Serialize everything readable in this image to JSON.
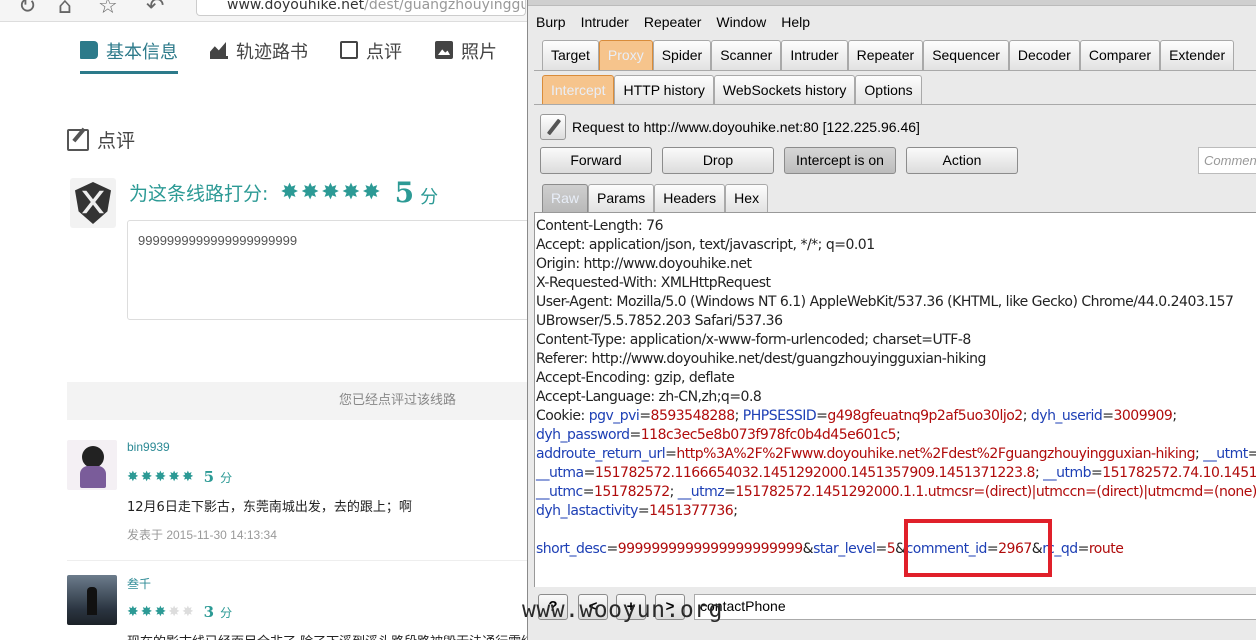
{
  "browser": {
    "url_domain": "www.doyouhike.net",
    "url_path": "/dest/guangzhouyinggu"
  },
  "site_tabs": [
    {
      "label": "基本信息",
      "active": true
    },
    {
      "label": "轨迹路书",
      "active": false
    },
    {
      "label": "点评",
      "active": false
    },
    {
      "label": "照片",
      "active": false
    }
  ],
  "review": {
    "heading": "点评",
    "rate_label": "为这条线路打分:",
    "stars": 5,
    "score": "5",
    "score_unit": "分",
    "textarea_value": "9999999999999999999999",
    "already_reviewed": "您已经点评过该线路"
  },
  "comments": [
    {
      "user": "bin9939",
      "stars": 5,
      "score": "5",
      "unit": "分",
      "text": "12月6日走下影古，东莞南城出发，去的跟上；啊",
      "date": "发表于 2015-11-30 14:13:34"
    },
    {
      "user": "叁千",
      "stars": 3,
      "score": "3",
      "unit": "分",
      "text": "现在的影古线已经面目全非了,除了下溪到溪头路段路被毁无法通行需绕水泥路外",
      "date": ""
    }
  ],
  "burp": {
    "menu": [
      "Burp",
      "Intruder",
      "Repeater",
      "Window",
      "Help"
    ],
    "main_tabs": [
      "Target",
      "Proxy",
      "Spider",
      "Scanner",
      "Intruder",
      "Repeater",
      "Sequencer",
      "Decoder",
      "Comparer",
      "Extender"
    ],
    "main_selected": "Proxy",
    "sub_tabs": [
      "Intercept",
      "HTTP history",
      "WebSockets history",
      "Options"
    ],
    "sub_selected": "Intercept",
    "request_to": "Request to http://www.doyouhike.net:80  [122.225.96.46]",
    "buttons": {
      "forward": "Forward",
      "drop": "Drop",
      "intercept": "Intercept is on",
      "action": "Action"
    },
    "comment_placeholder": "Comment",
    "view_tabs": [
      "Raw",
      "Params",
      "Headers",
      "Hex"
    ],
    "view_selected": "Raw",
    "headers": [
      "Content-Length: 76",
      "Accept: application/json, text/javascript, */*; q=0.01",
      "Origin: http://www.doyouhike.net",
      "X-Requested-With: XMLHttpRequest",
      "User-Agent: Mozilla/5.0 (Windows NT 6.1) AppleWebKit/537.36 (KHTML, like Gecko) Chrome/44.0.2403.157",
      "UBrowser/5.5.7852.203 Safari/537.36",
      "Content-Type: application/x-www-form-urlencoded; charset=UTF-8",
      "Referer: http://www.doyouhike.net/dest/guangzhouyingguxian-hiking",
      "Accept-Encoding: gzip, deflate",
      "Accept-Language: zh-CN,zh;q=0.8"
    ],
    "cookie_label": "Cookie: ",
    "cookies": [
      [
        [
          "pgv_pvi",
          "8593548288"
        ],
        [
          "PHPSESSID",
          "g498gfeuatnq9p2af5uo30ljo2"
        ],
        [
          "dyh_userid",
          "3009909"
        ]
      ],
      [
        [
          "dyh_password",
          "118c3ec5e8b073f978fc0b4d45e601c5"
        ]
      ],
      [
        [
          "addroute_return_url",
          "http%3A%2F%2Fwww.doyouhike.net%2Fdest%2Fguangzhouyingguxian-hiking"
        ],
        [
          "__utmt",
          ""
        ]
      ],
      [
        [
          "__utma",
          "151782572.1166654032.1451292000.1451357909.1451371223.8"
        ],
        [
          "__utmb",
          "151782572.74.10.1451371223"
        ]
      ],
      [
        [
          "__utmc",
          "151782572"
        ],
        [
          "__utmz",
          "151782572.1451292000.1.1.utmcsr=(direct)|utmccn=(direct)|utmcmd=(none)"
        ]
      ],
      [
        [
          "dyh_lastactivity",
          "1451377736"
        ]
      ]
    ],
    "body_params": [
      [
        "short_desc",
        "9999999999999999999999"
      ],
      [
        "star_level",
        "5"
      ],
      [
        "comment_id",
        "2967"
      ],
      [
        "rc_qd",
        "route"
      ]
    ],
    "search_value": "contactPhone",
    "search_buttons": [
      "?",
      "<",
      "+",
      ">"
    ]
  },
  "watermark": "www.wooyun.org",
  "colors": {
    "accent": "#2c9a95",
    "proxy_tab": "#f6c48c",
    "highlight": "#e0202a",
    "param_name": "#1d3fb5",
    "param_value": "#b00b0b"
  }
}
